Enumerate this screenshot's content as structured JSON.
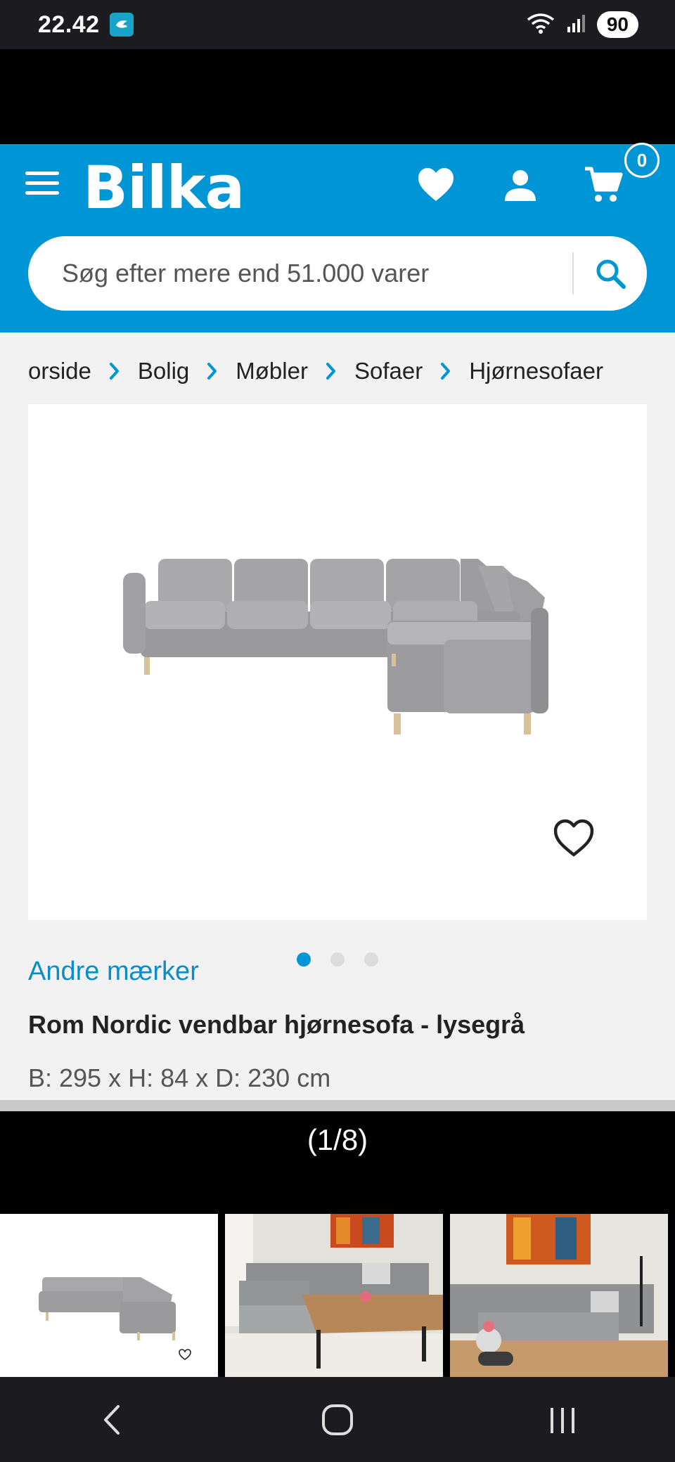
{
  "status_bar": {
    "time": "22.42",
    "battery": "90",
    "icons": [
      "app-notification-icon",
      "wifi-icon",
      "signal-icon",
      "battery-icon"
    ]
  },
  "header": {
    "logo": "Bilka",
    "cart_count": "0",
    "brand_color": "#0096d6",
    "icons": [
      "menu-icon",
      "heart-icon",
      "user-icon",
      "cart-icon"
    ]
  },
  "search": {
    "placeholder": "Søg efter mere end 51.000 varer",
    "icon": "search-icon"
  },
  "breadcrumb": [
    "orside",
    "Bolig",
    "Møbler",
    "Sofaer",
    "Hjørnesofaer"
  ],
  "product": {
    "brand": "Andre mærker",
    "title": "Rom Nordic vendbar hjørnesofa - lysegrå",
    "dimensions": "B: 295 x H: 84 x D: 230 cm",
    "image_dots": 3,
    "active_dot": 0
  },
  "viewer": {
    "counter": "(1/8)",
    "thumbnails": [
      "sofa-product-photo",
      "living-room-photo-1",
      "living-room-photo-2"
    ]
  },
  "nav_bar": {
    "icons": [
      "back-icon",
      "home-icon",
      "recents-icon"
    ]
  }
}
